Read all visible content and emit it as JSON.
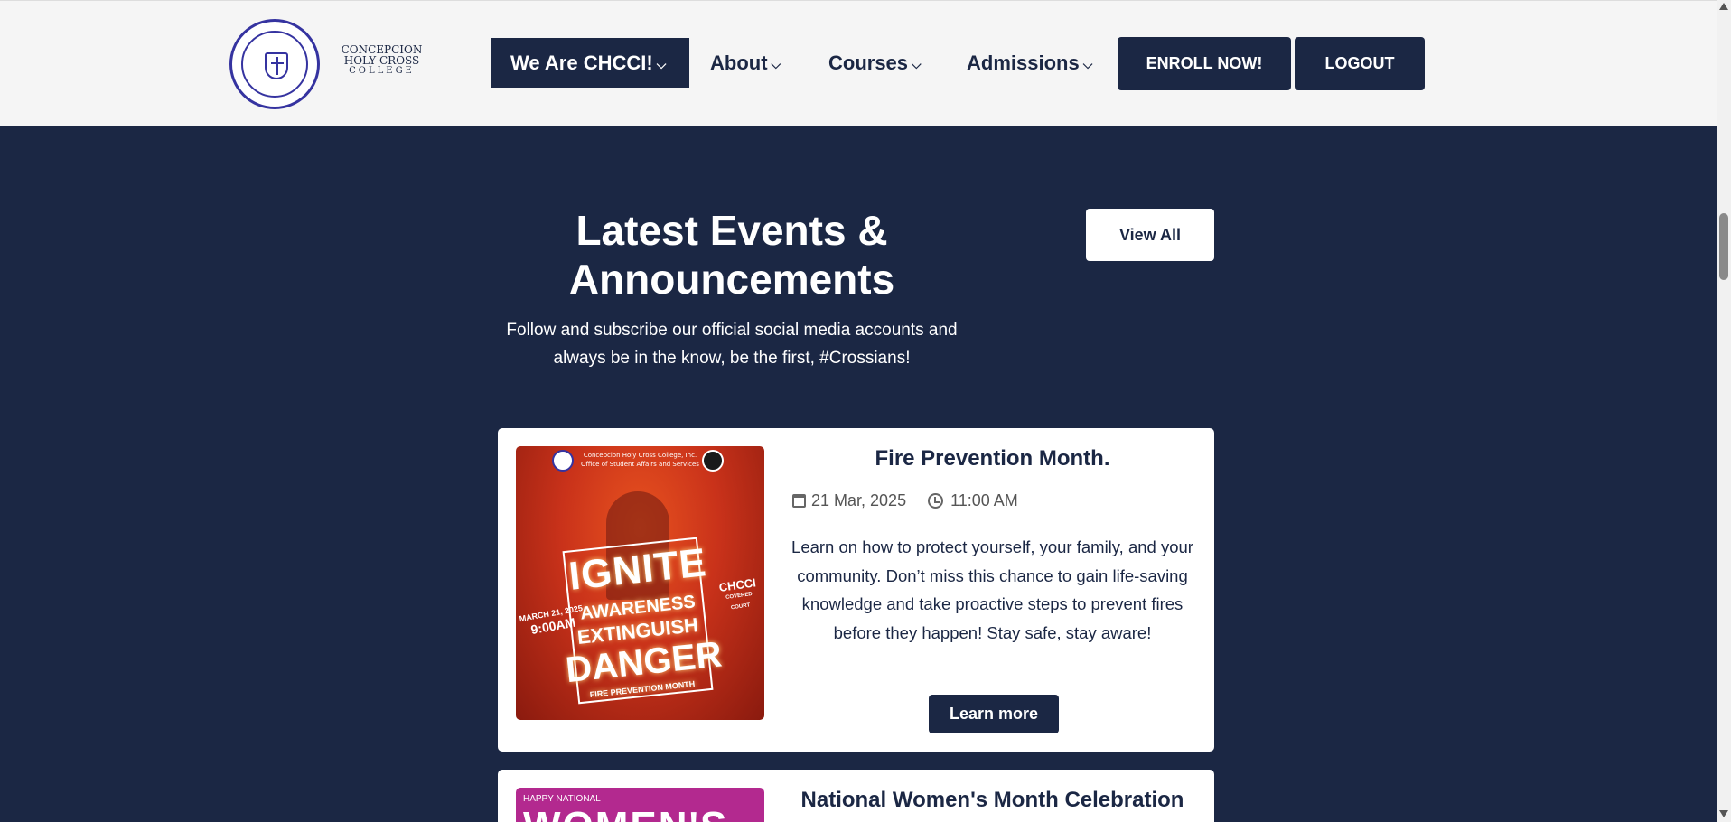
{
  "header": {
    "brand_line1": "CONCEPCION",
    "brand_line2": "HOLY CROSS",
    "brand_line3": "COLLEGE",
    "nav": {
      "we_are": "We Are CHCCI!",
      "about": "About",
      "courses": "Courses",
      "admissions": "Admissions"
    },
    "enroll_label": "ENROLL NOW!",
    "logout_label": "LOGOUT"
  },
  "section": {
    "title": "Latest Events & Announcements",
    "subtitle": "Follow and subscribe our official social media accounts and always be in the know, be the first, #Crossians!",
    "view_all_label": "View All"
  },
  "events": [
    {
      "title": "Fire Prevention Month.",
      "date": "21 Mar, 2025",
      "time": "11:00 AM",
      "description": "Learn on how to protect yourself, your family, and your community. Don’t miss this chance to gain life-saving knowledge and take proactive steps to prevent fires before they happen! Stay safe, stay aware!",
      "learn_more_label": "Learn more",
      "poster": {
        "org": "Concepcion Holy Cross College, Inc. Office of Student Affairs and Services",
        "word1": "IGNITE",
        "word2": "AWARENESS",
        "word3": "EXTINGUISH",
        "word4": "DANGER",
        "tagline": "FIRE PREVENTION MONTH",
        "date": "MARCH 21, 2025",
        "time": "9:00AM",
        "venue_name": "CHCCI",
        "venue_detail": "COVERED COURT"
      }
    },
    {
      "title": "National Women's Month Celebration",
      "poster": {
        "happy": "HAPPY NATIONAL",
        "word": "WOMEN'S"
      }
    }
  ],
  "colors": {
    "navy": "#1b2744",
    "header_bg": "#f5f5f5",
    "seal_blue": "#3533a0"
  },
  "icons": {
    "calendar": "calendar-icon",
    "clock": "clock-icon",
    "chevron": "chevron-down-icon"
  }
}
